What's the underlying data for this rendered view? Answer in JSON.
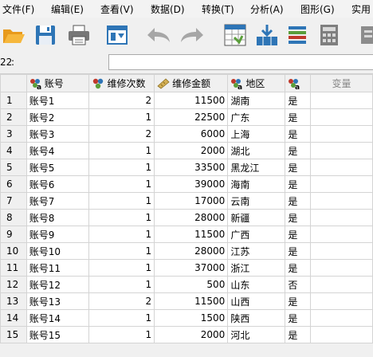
{
  "menu": [
    "文件(F)",
    "编辑(E)",
    "查看(V)",
    "数据(D)",
    "转换(T)",
    "分析(A)",
    "图形(G)",
    "实用"
  ],
  "toolbar": {
    "icons": [
      "open-folder-icon",
      "save-icon",
      "print-icon",
      "dialog-recall-icon",
      "undo-icon",
      "redo-icon",
      "goto-case-icon",
      "goto-variable-icon",
      "variables-icon",
      "calculator-icon",
      "more-icon"
    ]
  },
  "cell_editor": {
    "ref": "22",
    "value": ""
  },
  "columns": [
    {
      "name": "账号",
      "type": "string",
      "icon": "nominal-string-icon"
    },
    {
      "name": "维修次数",
      "type": "numeric",
      "icon": "nominal-icon"
    },
    {
      "name": "维修金额",
      "type": "numeric",
      "icon": "scale-icon"
    },
    {
      "name": "地区",
      "type": "string",
      "icon": "nominal-string-icon"
    },
    {
      "name": "",
      "type": "string",
      "icon": "nominal-string-icon"
    },
    {
      "name": "变量",
      "type": "empty",
      "icon": ""
    }
  ],
  "rows": [
    {
      "n": "1",
      "account": "账号1",
      "count": "2",
      "amount": "11500",
      "region": "湖南",
      "flag": "是"
    },
    {
      "n": "2",
      "account": "账号2",
      "count": "1",
      "amount": "22500",
      "region": "广东",
      "flag": "是"
    },
    {
      "n": "3",
      "account": "账号3",
      "count": "2",
      "amount": "6000",
      "region": "上海",
      "flag": "是"
    },
    {
      "n": "4",
      "account": "账号4",
      "count": "1",
      "amount": "2000",
      "region": "湖北",
      "flag": "是"
    },
    {
      "n": "5",
      "account": "账号5",
      "count": "1",
      "amount": "33500",
      "region": "黑龙江",
      "flag": "是"
    },
    {
      "n": "6",
      "account": "账号6",
      "count": "1",
      "amount": "39000",
      "region": "海南",
      "flag": "是"
    },
    {
      "n": "7",
      "account": "账号7",
      "count": "1",
      "amount": "17000",
      "region": "云南",
      "flag": "是"
    },
    {
      "n": "8",
      "account": "账号8",
      "count": "1",
      "amount": "28000",
      "region": "新疆",
      "flag": "是"
    },
    {
      "n": "9",
      "account": "账号9",
      "count": "1",
      "amount": "11500",
      "region": "广西",
      "flag": "是"
    },
    {
      "n": "10",
      "account": "账号10",
      "count": "1",
      "amount": "28000",
      "region": "江苏",
      "flag": "是"
    },
    {
      "n": "11",
      "account": "账号11",
      "count": "1",
      "amount": "37000",
      "region": "浙江",
      "flag": "是"
    },
    {
      "n": "12",
      "account": "账号12",
      "count": "1",
      "amount": "500",
      "region": "山东",
      "flag": "否"
    },
    {
      "n": "13",
      "account": "账号13",
      "count": "2",
      "amount": "11500",
      "region": "山西",
      "flag": "是"
    },
    {
      "n": "14",
      "account": "账号14",
      "count": "1",
      "amount": "1500",
      "region": "陕西",
      "flag": "是"
    },
    {
      "n": "15",
      "account": "账号15",
      "count": "1",
      "amount": "2000",
      "region": "河北",
      "flag": "是"
    }
  ],
  "colors": {
    "accent": "#2e75b6",
    "header_bg": "#f0f0f0"
  }
}
